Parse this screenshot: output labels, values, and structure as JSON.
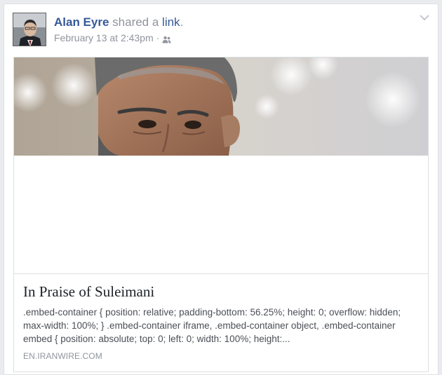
{
  "post": {
    "author_name": "Alan Eyre",
    "action_text": " shared a ",
    "action_link": "link",
    "action_end": ".",
    "timestamp": "February 13 at 2:43pm",
    "separator": "·",
    "audience_icon": "friends-icon",
    "menu_icon": "chevron-down-icon"
  },
  "link_preview": {
    "title": "In Praise of Suleimani",
    "description": ".embed-container { position: relative; padding-bottom: 56.25%; height: 0; overflow: hidden; max-width: 100%; } .embed-container iframe, .embed-container object, .embed-container embed { position: absolute; top: 0; left: 0; width: 100%; height:...",
    "domain": "EN.IRANWIRE.COM"
  },
  "colors": {
    "author_link": "#365899",
    "meta_text": "#90949c",
    "title_text": "#1d2129",
    "body_text": "#4b4f56",
    "border": "#dddfe2"
  }
}
